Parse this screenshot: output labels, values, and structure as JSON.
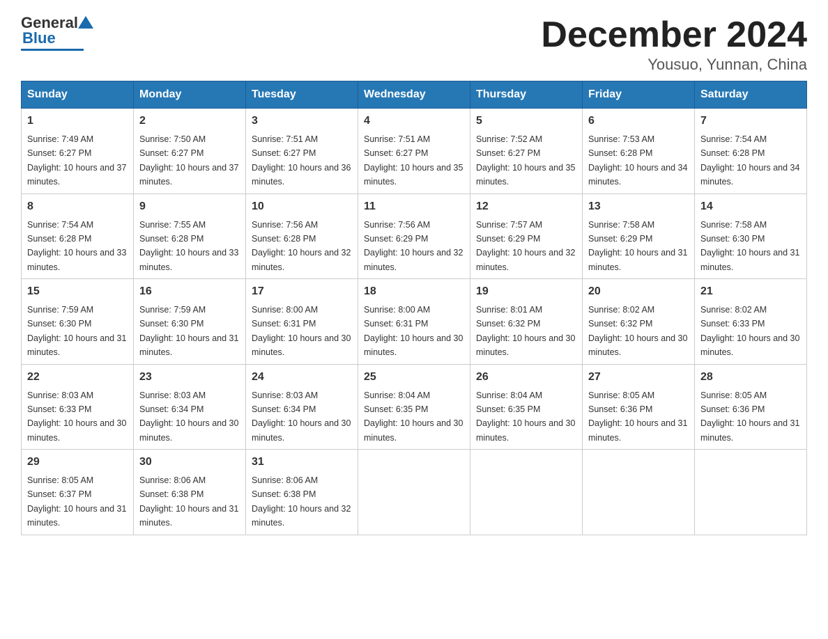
{
  "logo": {
    "general": "General",
    "blue": "Blue"
  },
  "title": "December 2024",
  "location": "Yousuo, Yunnan, China",
  "weekdays": [
    "Sunday",
    "Monday",
    "Tuesday",
    "Wednesday",
    "Thursday",
    "Friday",
    "Saturday"
  ],
  "weeks": [
    [
      {
        "day": "1",
        "sunrise": "7:49 AM",
        "sunset": "6:27 PM",
        "daylight": "10 hours and 37 minutes."
      },
      {
        "day": "2",
        "sunrise": "7:50 AM",
        "sunset": "6:27 PM",
        "daylight": "10 hours and 37 minutes."
      },
      {
        "day": "3",
        "sunrise": "7:51 AM",
        "sunset": "6:27 PM",
        "daylight": "10 hours and 36 minutes."
      },
      {
        "day": "4",
        "sunrise": "7:51 AM",
        "sunset": "6:27 PM",
        "daylight": "10 hours and 35 minutes."
      },
      {
        "day": "5",
        "sunrise": "7:52 AM",
        "sunset": "6:27 PM",
        "daylight": "10 hours and 35 minutes."
      },
      {
        "day": "6",
        "sunrise": "7:53 AM",
        "sunset": "6:28 PM",
        "daylight": "10 hours and 34 minutes."
      },
      {
        "day": "7",
        "sunrise": "7:54 AM",
        "sunset": "6:28 PM",
        "daylight": "10 hours and 34 minutes."
      }
    ],
    [
      {
        "day": "8",
        "sunrise": "7:54 AM",
        "sunset": "6:28 PM",
        "daylight": "10 hours and 33 minutes."
      },
      {
        "day": "9",
        "sunrise": "7:55 AM",
        "sunset": "6:28 PM",
        "daylight": "10 hours and 33 minutes."
      },
      {
        "day": "10",
        "sunrise": "7:56 AM",
        "sunset": "6:28 PM",
        "daylight": "10 hours and 32 minutes."
      },
      {
        "day": "11",
        "sunrise": "7:56 AM",
        "sunset": "6:29 PM",
        "daylight": "10 hours and 32 minutes."
      },
      {
        "day": "12",
        "sunrise": "7:57 AM",
        "sunset": "6:29 PM",
        "daylight": "10 hours and 32 minutes."
      },
      {
        "day": "13",
        "sunrise": "7:58 AM",
        "sunset": "6:29 PM",
        "daylight": "10 hours and 31 minutes."
      },
      {
        "day": "14",
        "sunrise": "7:58 AM",
        "sunset": "6:30 PM",
        "daylight": "10 hours and 31 minutes."
      }
    ],
    [
      {
        "day": "15",
        "sunrise": "7:59 AM",
        "sunset": "6:30 PM",
        "daylight": "10 hours and 31 minutes."
      },
      {
        "day": "16",
        "sunrise": "7:59 AM",
        "sunset": "6:30 PM",
        "daylight": "10 hours and 31 minutes."
      },
      {
        "day": "17",
        "sunrise": "8:00 AM",
        "sunset": "6:31 PM",
        "daylight": "10 hours and 30 minutes."
      },
      {
        "day": "18",
        "sunrise": "8:00 AM",
        "sunset": "6:31 PM",
        "daylight": "10 hours and 30 minutes."
      },
      {
        "day": "19",
        "sunrise": "8:01 AM",
        "sunset": "6:32 PM",
        "daylight": "10 hours and 30 minutes."
      },
      {
        "day": "20",
        "sunrise": "8:02 AM",
        "sunset": "6:32 PM",
        "daylight": "10 hours and 30 minutes."
      },
      {
        "day": "21",
        "sunrise": "8:02 AM",
        "sunset": "6:33 PM",
        "daylight": "10 hours and 30 minutes."
      }
    ],
    [
      {
        "day": "22",
        "sunrise": "8:03 AM",
        "sunset": "6:33 PM",
        "daylight": "10 hours and 30 minutes."
      },
      {
        "day": "23",
        "sunrise": "8:03 AM",
        "sunset": "6:34 PM",
        "daylight": "10 hours and 30 minutes."
      },
      {
        "day": "24",
        "sunrise": "8:03 AM",
        "sunset": "6:34 PM",
        "daylight": "10 hours and 30 minutes."
      },
      {
        "day": "25",
        "sunrise": "8:04 AM",
        "sunset": "6:35 PM",
        "daylight": "10 hours and 30 minutes."
      },
      {
        "day": "26",
        "sunrise": "8:04 AM",
        "sunset": "6:35 PM",
        "daylight": "10 hours and 30 minutes."
      },
      {
        "day": "27",
        "sunrise": "8:05 AM",
        "sunset": "6:36 PM",
        "daylight": "10 hours and 31 minutes."
      },
      {
        "day": "28",
        "sunrise": "8:05 AM",
        "sunset": "6:36 PM",
        "daylight": "10 hours and 31 minutes."
      }
    ],
    [
      {
        "day": "29",
        "sunrise": "8:05 AM",
        "sunset": "6:37 PM",
        "daylight": "10 hours and 31 minutes."
      },
      {
        "day": "30",
        "sunrise": "8:06 AM",
        "sunset": "6:38 PM",
        "daylight": "10 hours and 31 minutes."
      },
      {
        "day": "31",
        "sunrise": "8:06 AM",
        "sunset": "6:38 PM",
        "daylight": "10 hours and 32 minutes."
      },
      null,
      null,
      null,
      null
    ]
  ],
  "labels": {
    "sunrise_prefix": "Sunrise: ",
    "sunset_prefix": "Sunset: ",
    "daylight_prefix": "Daylight: "
  }
}
